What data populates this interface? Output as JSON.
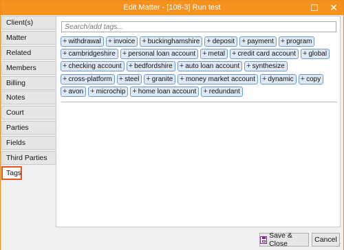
{
  "window": {
    "title": "Edit Matter - [108-3] Run test"
  },
  "titlebar": {
    "maximize_icon": "maximize-icon",
    "close_icon": "close-icon"
  },
  "sidebar": {
    "items": [
      {
        "label": "Client(s)"
      },
      {
        "label": "Matter"
      },
      {
        "label": "Related Matters"
      },
      {
        "label": "Members"
      },
      {
        "label": "Billing"
      },
      {
        "label": "Notes"
      },
      {
        "label": "Court"
      },
      {
        "label": "Parties"
      },
      {
        "label": "Fields"
      },
      {
        "label": "Third Parties"
      },
      {
        "label": "Tags",
        "active": true
      }
    ]
  },
  "search": {
    "placeholder": "Search/add tags..."
  },
  "tags": [
    "withdrawal",
    "invoice",
    "buckinghamshire",
    "deposit",
    "payment",
    "program",
    "cambridgeshire",
    "personal loan account",
    "metal",
    "credit card account",
    "global",
    "checking account",
    "bedfordshire",
    "auto loan account",
    "synthesize",
    "cross-platform",
    "steel",
    "granite",
    "money market account",
    "dynamic",
    "copy",
    "avon",
    "microchip",
    "home loan account",
    "redundant"
  ],
  "buttons": {
    "save": "Save & Close",
    "cancel": "Cancel"
  },
  "colors": {
    "titlebar": "#f5921e",
    "active_tab_border": "#e9541d",
    "tag_bg": "#dfe9f5",
    "tag_border": "#6f98c9"
  }
}
